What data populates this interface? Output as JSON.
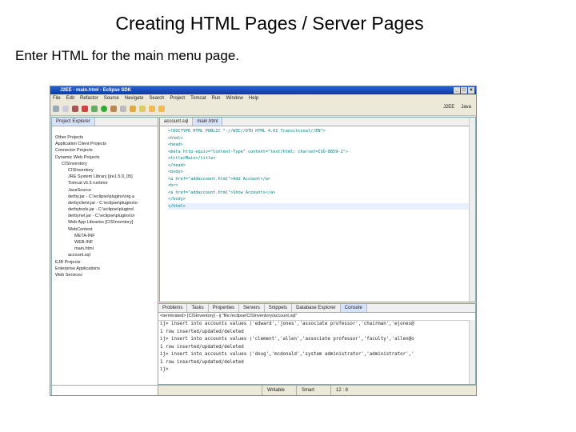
{
  "slide": {
    "title": "Creating HTML Pages / Server Pages",
    "subtitle": "Enter HTML for the main menu page."
  },
  "window": {
    "title": "J2EE - main.html - Eclipse SDK",
    "menu": [
      "File",
      "Edit",
      "Refactor",
      "Source",
      "Navigate",
      "Search",
      "Project",
      "Tomcat",
      "Run",
      "Window",
      "Help"
    ],
    "perspectives": [
      "J2EE",
      "Java"
    ]
  },
  "explorer": {
    "tab": "Project Explorer",
    "items": [
      {
        "label": "Other Projects",
        "level": 0
      },
      {
        "label": "Application Client Projects",
        "level": 0
      },
      {
        "label": "Connector Projects",
        "level": 0
      },
      {
        "label": "Dynamic Web Projects",
        "level": 0
      },
      {
        "label": "CISInventory",
        "level": 1
      },
      {
        "label": "CISInventory",
        "level": 2
      },
      {
        "label": "JRE System Library [jre1.5.0_05]",
        "level": 2
      },
      {
        "label": "Tomcat v5.5 runtime",
        "level": 2
      },
      {
        "label": "JavaSource",
        "level": 2
      },
      {
        "label": "derby.jar - C:\\eclipse\\plugins\\org.a",
        "level": 2
      },
      {
        "label": "derbyclient.jar - C:\\eclipse\\plugins\\o",
        "level": 2
      },
      {
        "label": "derbytools.jar - C:\\eclipse\\plugins\\",
        "level": 2
      },
      {
        "label": "derbynet.jar - C:\\eclipse\\plugins\\or",
        "level": 2
      },
      {
        "label": "Web App Libraries [CISInventory]",
        "level": 2
      },
      {
        "label": "WebContent",
        "level": 2
      },
      {
        "label": "META-INF",
        "level": 3
      },
      {
        "label": "WEB-INF",
        "level": 3
      },
      {
        "label": "main.html",
        "level": 3
      },
      {
        "label": "account.sql",
        "level": 2
      },
      {
        "label": "EJB Projects",
        "level": 0
      },
      {
        "label": "Enterprise Applications",
        "level": 0
      },
      {
        "label": "Web Services",
        "level": 0
      }
    ]
  },
  "editor": {
    "tabs": [
      "account.sql",
      "main.html"
    ],
    "lines": [
      "<!DOCTYPE HTML PUBLIC \"-//W3C//DTD HTML 4.01 Transitional//EN\">",
      "<html>",
      "<head>",
      "<meta http-equiv=\"Content-Type\" content=\"text/html; charset=ISO-8859-1\">",
      "<title>Main</title>",
      "</head>",
      "<body>",
      "<a href=\"addaccount.html\">Add Account</a>",
      "<br>",
      "<a href=\"addaccount.html\">Show Accounts</a>",
      "</body>",
      "</html>"
    ]
  },
  "console": {
    "tabs": [
      "Problems",
      "Tasks",
      "Properties",
      "Servers",
      "Snippets",
      "Database Explorer",
      "Console"
    ],
    "header": "<terminated> [CISInventory] - ij \"file:/eclipse/CISInventory/account.sql\"",
    "lines": [
      "ij> insert into accounts values ('edward','jones','associate professor','chairman','ejones@",
      "1 row inserted/updated/deleted",
      "ij> insert into accounts values ('clement','allen','associate professor','faculty','allen@o",
      "1 row inserted/updated/deleted",
      "ij> insert into accounts values ('doug','mcdonald','system administrator','administrator','",
      "1 row inserted/updated/deleted",
      "ij>"
    ]
  },
  "status": {
    "mode": "Writable",
    "insert": "Smart Insert",
    "position": "12 : 8"
  }
}
